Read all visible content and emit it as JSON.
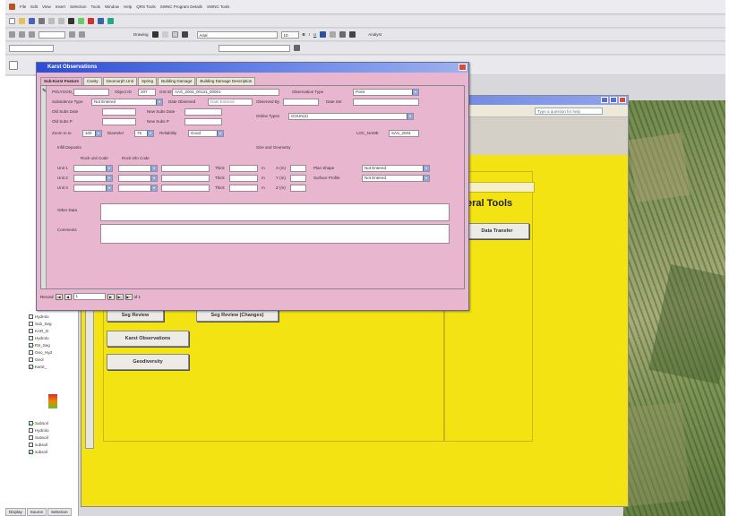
{
  "menu": [
    "File",
    "Edit",
    "View",
    "Insert",
    "Selection",
    "Tools",
    "Window",
    "Help",
    "QRS Tools",
    "SWNC Program Details",
    "SWNC Tools"
  ],
  "toolbar": {
    "drawing_label": "Drawing",
    "font_select": "Arial",
    "font_size": "10",
    "bold": "B",
    "italic": "I",
    "underline": "U",
    "georef_label": "Analyst"
  },
  "access": {
    "ask_placeholder": "Type a question for help",
    "section_title": "eral Tools",
    "buttons": {
      "transfer": "Data Transfer",
      "seg_review": "Seg Review",
      "seg_changes": "Seg Review (Changes)",
      "karst": "Karst Observations",
      "geodiversity": "Geodiversity"
    }
  },
  "toc": {
    "layers": [
      "Hydrolo",
      "Sub_Seg",
      "KAR_O",
      "Hydrolo",
      "RS_Seg",
      "Geo_Hyd",
      "Geol",
      "Karst_",
      "Subsoil",
      "Hydrolo",
      "Subsoil",
      "subsoil",
      "subsoil"
    ],
    "tabs": [
      "Display",
      "Source",
      "Selection"
    ]
  },
  "karst_form": {
    "title": "Karst Observations",
    "tabs": [
      "Sub-Karst Feature",
      "Cavity",
      "Geomorph Unit",
      "Spring",
      "Building Damage",
      "Building Damage Description"
    ],
    "fields": {
      "polygon_id_label": "POLYGON_ID",
      "object_id_label": "Object ID",
      "object_id_value": "207",
      "gis_id_label": "GIS ID",
      "gis_id_value": "AAS_2003_00131_00001",
      "obs_type_label": "Observation Type",
      "obs_type_value": "Point",
      "subsidence_type_label": "Subsidence Type",
      "subsidence_type_value": "Not Entered",
      "date_observed_label": "Date Observed",
      "date_observed_value": "Date Entered",
      "observed_by_label": "Observed By",
      "date_set_label": "Date Set",
      "old_subs_date_label": "Old Subs Date",
      "new_subs_date_label": "New Subs Date",
      "old_subs_p_label": "Old Subs P",
      "new_subs_p_label": "New Subs P",
      "online_type_label": "Online Types",
      "online_type_value": "GOUN(4)",
      "zoom_to_label": "Zoom to to",
      "zoom_value": "100",
      "diameter_label": "Diameter",
      "diameter_value": "75",
      "reliability_label": "Reliability",
      "reliability_value": "Good",
      "loc_name_label": "LOC_NAME",
      "loc_name_value": "SAS_2004",
      "infill_label": "Infill Deposits",
      "rock_unit_code_label": "Rock unit Code",
      "rock_info_code_label": "Rock info Code",
      "unit1": "Unit 1",
      "unit2": "Unit 2",
      "unit3": "Unit 3",
      "thick": "Thick",
      "m": "m",
      "size_geom_label": "Size and Geometry",
      "x_m": "X (m)",
      "y_m": "Y (m)",
      "z_m": "Z (m)",
      "plan_shape_label": "Plan Shape",
      "plan_shape_value": "Not Entered",
      "surface_profile_label": "Surface Profile",
      "surface_profile_value": "Not Entered",
      "other_data_label": "Other Data",
      "comments_label": "Comments"
    },
    "record": {
      "label": "Record",
      "current": "1",
      "of": "of 1"
    }
  },
  "colors": {
    "form_bg": "#e8b7cf",
    "switchboard_bg": "#f4e313",
    "title_bar": "#2d4ed3"
  }
}
